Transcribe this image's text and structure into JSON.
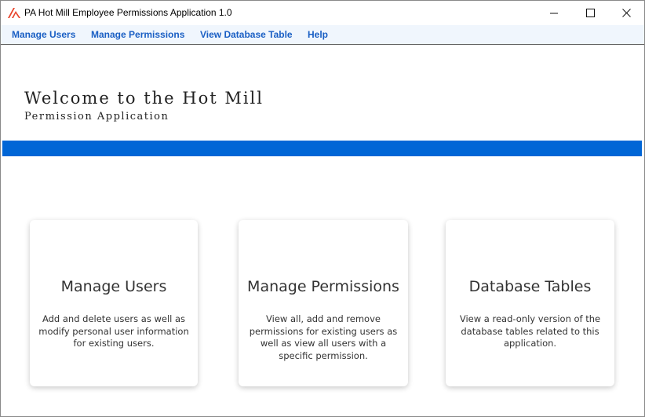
{
  "window": {
    "title": "PA Hot Mill Employee Permissions Application 1.0",
    "controls": {
      "minimize": "—",
      "maximize": "☐",
      "close": "✕"
    }
  },
  "menu": [
    {
      "label": "Manage Users"
    },
    {
      "label": "Manage Permissions"
    },
    {
      "label": "View Database Table"
    },
    {
      "label": "Help"
    }
  ],
  "header": {
    "title": "Welcome to the Hot Mill",
    "subtitle": "Permission Application",
    "band_color": "#0066d6"
  },
  "cards": [
    {
      "title": "Manage Users",
      "description": "Add and delete users as well as modify personal user information for existing users."
    },
    {
      "title": "Manage Permissions",
      "description": "View all, add and remove permissions for existing users as well as view all users with a specific permission."
    },
    {
      "title": "Database Tables",
      "description": "View a read-only version of the database tables related to this application."
    }
  ],
  "colors": {
    "menu_text": "#1a5fc4",
    "menu_bg": "#f0f6fd",
    "accent": "#0066d6",
    "icon": "#e8442c"
  }
}
